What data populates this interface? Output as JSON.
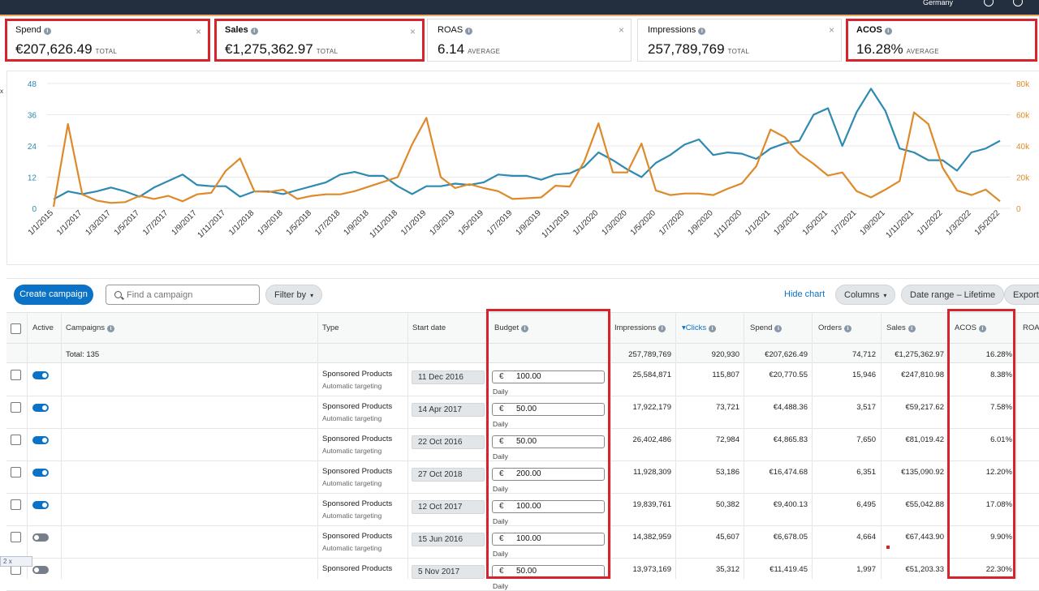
{
  "topbar": {
    "country": "Germany"
  },
  "metrics": [
    {
      "label": "Spend",
      "value": "€207,626.49",
      "type": "TOTAL",
      "bold": false
    },
    {
      "label": "Sales",
      "value": "€1,275,362.97",
      "type": "TOTAL",
      "bold": true
    },
    {
      "label": "ROAS",
      "value": "6.14",
      "type": "AVERAGE",
      "bold": false
    },
    {
      "label": "Impressions",
      "value": "257,789,769",
      "type": "TOTAL",
      "bold": false
    },
    {
      "label": "ACOS",
      "value": "16.28%",
      "type": "AVERAGE",
      "bold": true
    }
  ],
  "close_glyph": "×",
  "chart_left_edge_glyph": "x",
  "chart_data": {
    "type": "line",
    "x": [
      "1/1/2015",
      "1/1/2017",
      "1/3/2017",
      "1/5/2017",
      "1/7/2017",
      "1/9/2017",
      "1/11/2017",
      "1/1/2018",
      "1/3/2018",
      "1/5/2018",
      "1/7/2018",
      "1/9/2018",
      "1/11/2018",
      "1/1/2019",
      "1/3/2019",
      "1/5/2019",
      "1/7/2019",
      "1/9/2019",
      "1/11/2019",
      "1/1/2020",
      "1/3/2020",
      "1/5/2020",
      "1/7/2020",
      "1/9/2020",
      "1/11/2020",
      "1/1/2021",
      "1/3/2021",
      "1/5/2021",
      "1/7/2021",
      "1/9/2021",
      "1/11/2021",
      "1/1/2022",
      "1/3/2022",
      "1/5/2022"
    ],
    "left_ticks": [
      "0",
      "12",
      "24",
      "36",
      "48"
    ],
    "right_ticks": [
      "0",
      "20k",
      "40k",
      "60k",
      "80k"
    ],
    "ylim_left": [
      0,
      48
    ],
    "ylim_right": [
      0,
      80000
    ],
    "series": [
      {
        "axis": "left",
        "color": "#2e8ab0",
        "values": [
          3.5,
          6.5,
          5.5,
          6.5,
          8,
          6.5,
          4.5,
          8,
          10.5,
          13,
          9,
          8.5,
          8.5,
          4.5,
          6.5,
          6.5,
          5.5,
          7,
          8.5,
          10,
          13,
          14,
          12.5,
          12.5,
          8.5,
          5.5,
          8.5,
          8.5,
          9.5,
          9,
          10,
          13,
          12.5,
          12.5,
          11,
          13,
          13.5,
          16,
          21.5,
          18.5,
          15,
          12,
          17.5,
          20.5,
          24.5,
          26.5,
          20.5,
          21.5,
          21,
          19,
          23,
          25,
          26,
          36,
          38.5,
          24,
          37,
          46,
          37.5,
          23,
          21.5,
          18.5,
          18.5,
          14.5,
          21.5,
          23,
          26
        ]
      },
      {
        "axis": "right",
        "color": "#de8a2a",
        "values": [
          1000,
          54000,
          9000,
          5000,
          3500,
          4000,
          8000,
          6000,
          8000,
          4500,
          9000,
          10000,
          24000,
          32000,
          11000,
          10500,
          12000,
          6000,
          8000,
          9000,
          9000,
          11000,
          14000,
          17000,
          20000,
          41000,
          58000,
          20000,
          13000,
          15500,
          13000,
          11000,
          6000,
          6500,
          7000,
          14500,
          14000,
          30000,
          54500,
          23000,
          23000,
          41500,
          11500,
          8500,
          9500,
          9500,
          8500,
          12500,
          16000,
          27000,
          50500,
          45500,
          35000,
          28500,
          21000,
          23000,
          11000,
          7000,
          12000,
          17500,
          61500,
          54000,
          26000,
          11500,
          8500,
          12000,
          4500
        ]
      }
    ]
  },
  "toolbar": {
    "create_label": "Create campaign",
    "search_placeholder": "Find a campaign",
    "filter_label": "Filter by",
    "hide_chart_label": "Hide chart",
    "columns_label": "Columns",
    "date_range_label": "Date range – Lifetime",
    "export_label": "Export"
  },
  "columns": {
    "active": "Active",
    "campaigns": "Campaigns",
    "type": "Type",
    "start_date": "Start date",
    "budget": "Budget",
    "impressions": "Impressions",
    "clicks": "Clicks",
    "spend": "Spend",
    "orders": "Orders",
    "sales": "Sales",
    "acos": "ACOS",
    "roas": "ROAS"
  },
  "totals": {
    "label": "Total: 135",
    "impressions": "257,789,769",
    "clicks": "920,930",
    "spend": "€207,626.49",
    "orders": "74,712",
    "sales": "€1,275,362.97",
    "acos": "16.28%"
  },
  "currency_symbol": "€",
  "daily_label": "Daily",
  "rows": [
    {
      "active": true,
      "type": "Sponsored Products",
      "targeting": "Automatic targeting",
      "start": "11 Dec 2016",
      "budget": "100.00",
      "impressions": "25,584,871",
      "clicks": "115,807",
      "spend": "€20,770.55",
      "orders": "15,946",
      "sales": "€247,810.98",
      "acos": "8.38%"
    },
    {
      "active": true,
      "type": "Sponsored Products",
      "targeting": "Automatic targeting",
      "start": "14 Apr 2017",
      "budget": "50.00",
      "impressions": "17,922,179",
      "clicks": "73,721",
      "spend": "€4,488.36",
      "orders": "3,517",
      "sales": "€59,217.62",
      "acos": "7.58%"
    },
    {
      "active": true,
      "type": "Sponsored Products",
      "targeting": "Automatic targeting",
      "start": "22 Oct 2016",
      "budget": "50.00",
      "impressions": "26,402,486",
      "clicks": "72,984",
      "spend": "€4,865.83",
      "orders": "7,650",
      "sales": "€81,019.42",
      "acos": "6.01%"
    },
    {
      "active": true,
      "type": "Sponsored Products",
      "targeting": "Automatic targeting",
      "start": "27 Oct 2018",
      "budget": "200.00",
      "impressions": "11,928,309",
      "clicks": "53,186",
      "spend": "€16,474.68",
      "orders": "6,351",
      "sales": "€135,090.92",
      "acos": "12.20%"
    },
    {
      "active": true,
      "type": "Sponsored Products",
      "targeting": "Automatic targeting",
      "start": "12 Oct 2017",
      "budget": "100.00",
      "impressions": "19,839,761",
      "clicks": "50,382",
      "spend": "€9,400.13",
      "orders": "6,495",
      "sales": "€55,042.88",
      "acos": "17.08%"
    },
    {
      "active": false,
      "type": "Sponsored Products",
      "targeting": "Automatic targeting",
      "start": "15 Jun 2016",
      "budget": "100.00",
      "impressions": "14,382,959",
      "clicks": "45,607",
      "spend": "€6,678.05",
      "orders": "4,664",
      "sales": "€67,443.90",
      "acos": "9.90%"
    },
    {
      "active": false,
      "type": "Sponsored Products",
      "targeting": "",
      "start": "5 Nov 2017",
      "budget": "50.00",
      "impressions": "13,973,169",
      "clicks": "35,312",
      "spend": "€11,419.45",
      "orders": "1,997",
      "sales": "€51,203.33",
      "acos": "22.30%"
    }
  ],
  "zoom_chip": {
    "a": "2",
    "b": "x"
  }
}
